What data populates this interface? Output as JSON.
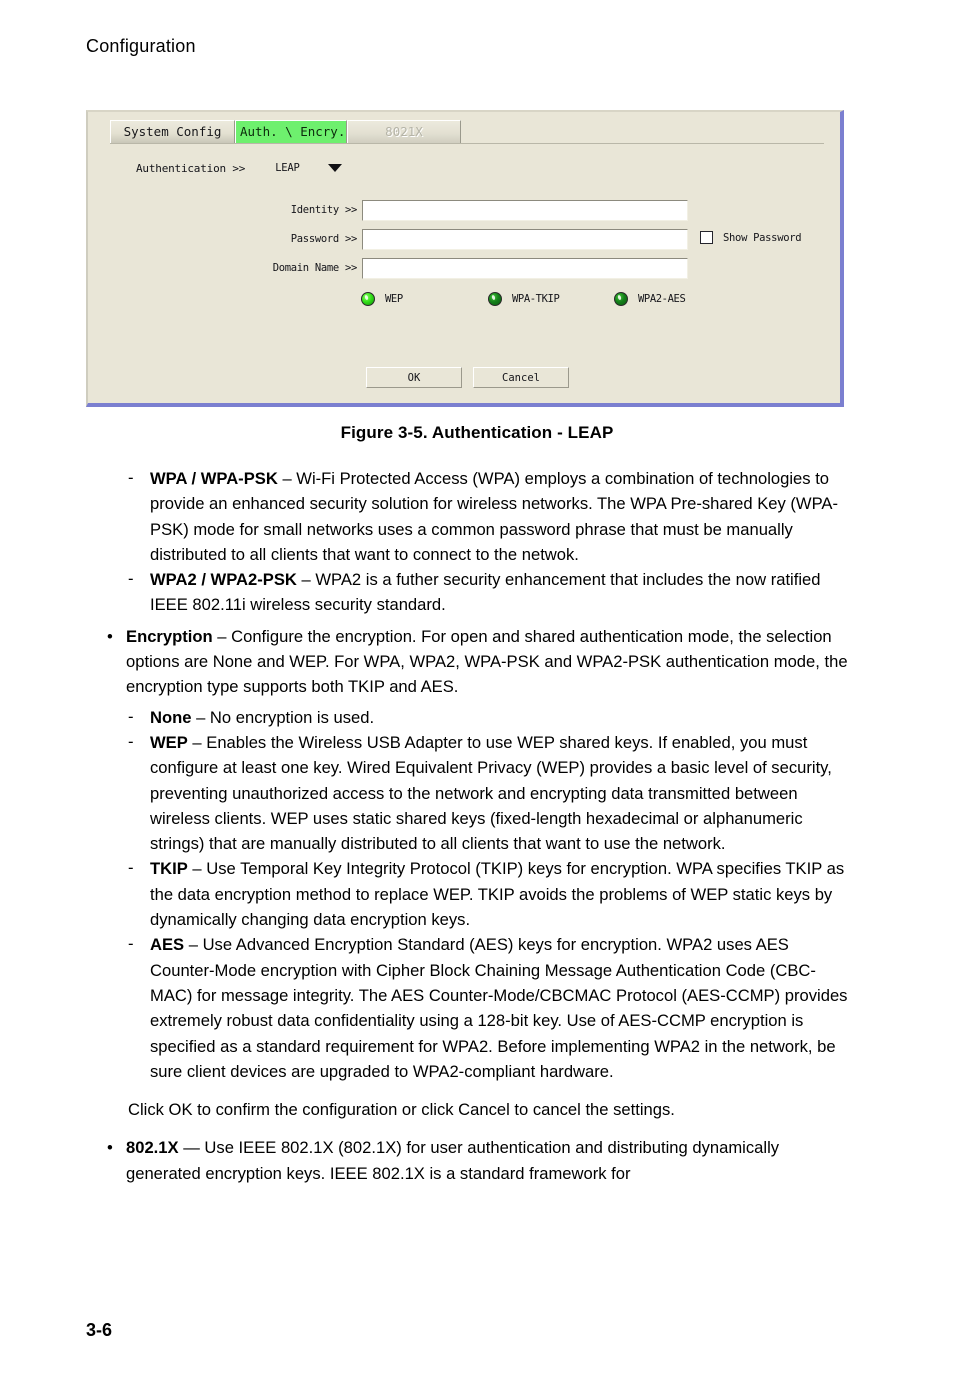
{
  "page": {
    "header": "Configuration",
    "footer": "3-6",
    "figure_caption": "Figure 3-5.  Authentication - LEAP"
  },
  "dialog": {
    "tabs": [
      {
        "label": "System Config",
        "state": "inactive"
      },
      {
        "label": "Auth. \\ Encry.",
        "state": "active"
      },
      {
        "label": "8021X",
        "state": "disabled"
      }
    ],
    "authentication": {
      "label": "Authentication >>",
      "value": "LEAP",
      "dropdown_icon": "chevron-down-icon"
    },
    "fields": [
      {
        "label": "Identity >>",
        "value": "",
        "placeholder": ""
      },
      {
        "label": "Password >>",
        "value": "",
        "placeholder": ""
      },
      {
        "label": "Domain Name >>",
        "value": "",
        "placeholder": ""
      }
    ],
    "show_password": {
      "label": "Show Password",
      "checked": false
    },
    "indicators": [
      {
        "label": "WEP",
        "color": "#34e019",
        "state": "bright"
      },
      {
        "label": "WPA-TKIP",
        "color": "#14801a",
        "state": "dim"
      },
      {
        "label": "WPA2-AES",
        "color": "#14801a",
        "state": "dim"
      }
    ],
    "buttons": {
      "ok": "OK",
      "cancel": "Cancel"
    },
    "colors": {
      "background": "#e9e6d7",
      "active_tab": "#6ef06e",
      "frame_accent": "#7b7fd0"
    }
  },
  "body": {
    "b1_term": "WPA / WPA-PSK",
    "b1_text": " – Wi-Fi Protected Access (WPA) employs a combination of technologies to provide an enhanced security solution for wireless networks. The WPA Pre-shared Key (WPA-PSK) mode for small networks uses a common password phrase that must be manually distributed to all clients that want to connect to the netwok.",
    "b2_term": "WPA2 / WPA2-PSK",
    "b2_text": " – WPA2 is a futher security enhancement that includes the now ratified IEEE 802.11i wireless security standard.",
    "b3_term": "Encryption",
    "b3_text": " – Configure the encryption. For open and shared authentication mode, the selection options are None and WEP. For WPA, WPA2, WPA-PSK and WPA2-PSK authentication mode, the encryption type supports both TKIP and AES.",
    "b4_term": "None",
    "b4_text": " – No encryption is used.",
    "b5_term": "WEP",
    "b5_text": " – Enables the Wireless USB Adapter to use WEP shared keys. If enabled, you must configure at least one key. Wired Equivalent Privacy (WEP) provides a basic level of security, preventing unauthorized access to the network and encrypting data transmitted between wireless clients. WEP uses static shared keys (fixed-length hexadecimal or alphanumeric strings) that are manually distributed to all clients that want to use the network.",
    "b6_term": "TKIP",
    "b6_text": " – Use Temporal Key Integrity Protocol (TKIP) keys for encryption. WPA specifies TKIP as the data encryption method to replace WEP. TKIP avoids the problems of WEP static keys by dynamically changing data encryption keys.",
    "b7_term": "AES",
    "b7_text": " – Use Advanced Encryption Standard (AES) keys for encryption. WPA2 uses AES Counter-Mode encryption with Cipher Block Chaining Message Authentication Code (CBC-MAC) for message integrity. The AES Counter-Mode/CBCMAC Protocol (AES-CCMP) provides extremely robust data confidentiality using a 128-bit key. Use of AES-CCMP encryption is specified as a standard requirement for WPA2. Before implementing WPA2 in the network, be sure client devices are upgraded to WPA2-compliant hardware.",
    "b8_text": "Click OK to confirm the configuration or click Cancel to cancel the settings.",
    "b9_term": "802.1X",
    "b9_text": " — Use IEEE 802.1X (802.1X) for user authentication and distributing dynamically generated encryption keys. IEEE 802.1X is a standard framework for",
    "dash_mark": "-",
    "bullet_mark": "•"
  }
}
